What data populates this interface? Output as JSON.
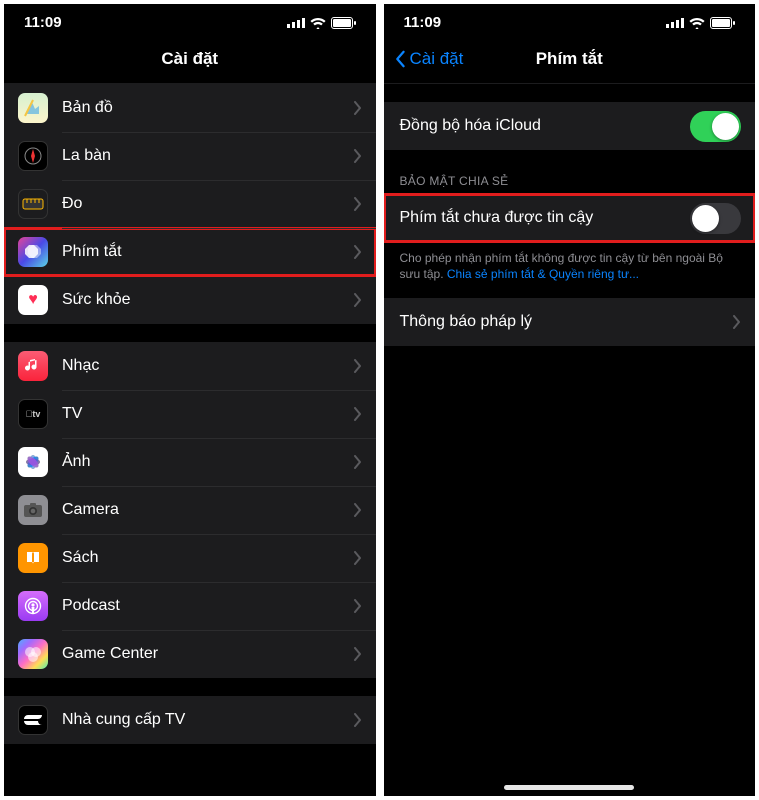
{
  "status": {
    "time": "11:09"
  },
  "left": {
    "title": "Cài đặt",
    "groups": [
      {
        "items": [
          {
            "icon": "maps-icon",
            "label": "Bản đồ"
          },
          {
            "icon": "compass-icon",
            "label": "La bàn"
          },
          {
            "icon": "measure-icon",
            "label": "Đo"
          },
          {
            "icon": "shortcuts-icon",
            "label": "Phím tắt",
            "highlight": true
          },
          {
            "icon": "health-icon",
            "label": "Sức khỏe"
          }
        ]
      },
      {
        "items": [
          {
            "icon": "music-icon",
            "label": "Nhạc"
          },
          {
            "icon": "tv-icon",
            "label": "TV"
          },
          {
            "icon": "photos-icon",
            "label": "Ảnh"
          },
          {
            "icon": "camera-icon",
            "label": "Camera"
          },
          {
            "icon": "books-icon",
            "label": "Sách"
          },
          {
            "icon": "podcast-icon",
            "label": "Podcast"
          },
          {
            "icon": "gamecenter-icon",
            "label": "Game Center"
          }
        ]
      },
      {
        "items": [
          {
            "icon": "tvprovider-icon",
            "label": "Nhà cung cấp TV"
          }
        ]
      }
    ]
  },
  "right": {
    "back": "Cài đặt",
    "title": "Phím tắt",
    "section1": {
      "label": "Đồng bộ hóa iCloud",
      "toggle": true
    },
    "section2": {
      "header": "BẢO MẬT CHIA SẺ",
      "row": {
        "label": "Phím tắt chưa được tin cậy",
        "toggle": false,
        "highlight": true
      },
      "footer_part1": "Cho phép nhận phím tắt không được tin cậy từ bên ngoài Bộ sưu tập. ",
      "footer_link": "Chia sẻ phím tắt & Quyền riêng tư..."
    },
    "section3": {
      "label": "Thông báo pháp lý"
    }
  }
}
